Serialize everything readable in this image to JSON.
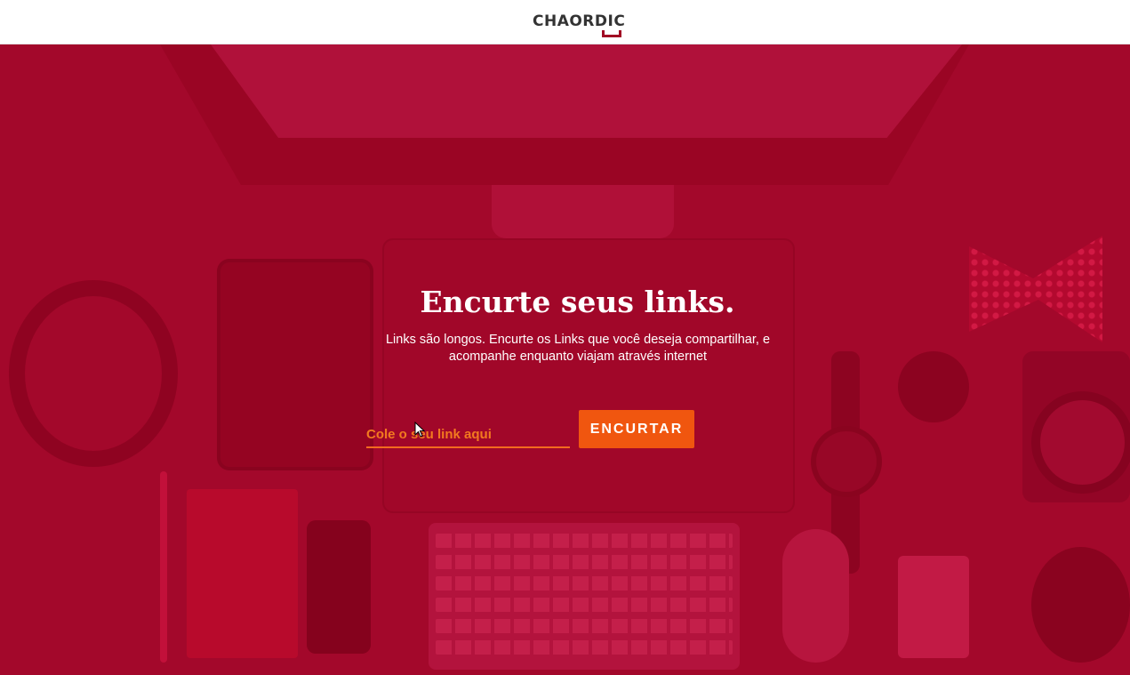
{
  "header": {
    "logo_text": "CHAORDIC",
    "logo_accent_color": "#a10a24"
  },
  "hero": {
    "background_color": "#a3082b",
    "title": "Encurte seus links.",
    "subtitle": "Links são longos. Encurte os Links que você deseja compartilhar, e acompanhe enquanto viajam através internet",
    "input": {
      "placeholder": "Cole o seu link aqui",
      "value": ""
    },
    "button_label": "ENCURTAR",
    "button_color": "#f0560f"
  },
  "icons": {
    "cursor": "mouse-pointer-icon"
  }
}
